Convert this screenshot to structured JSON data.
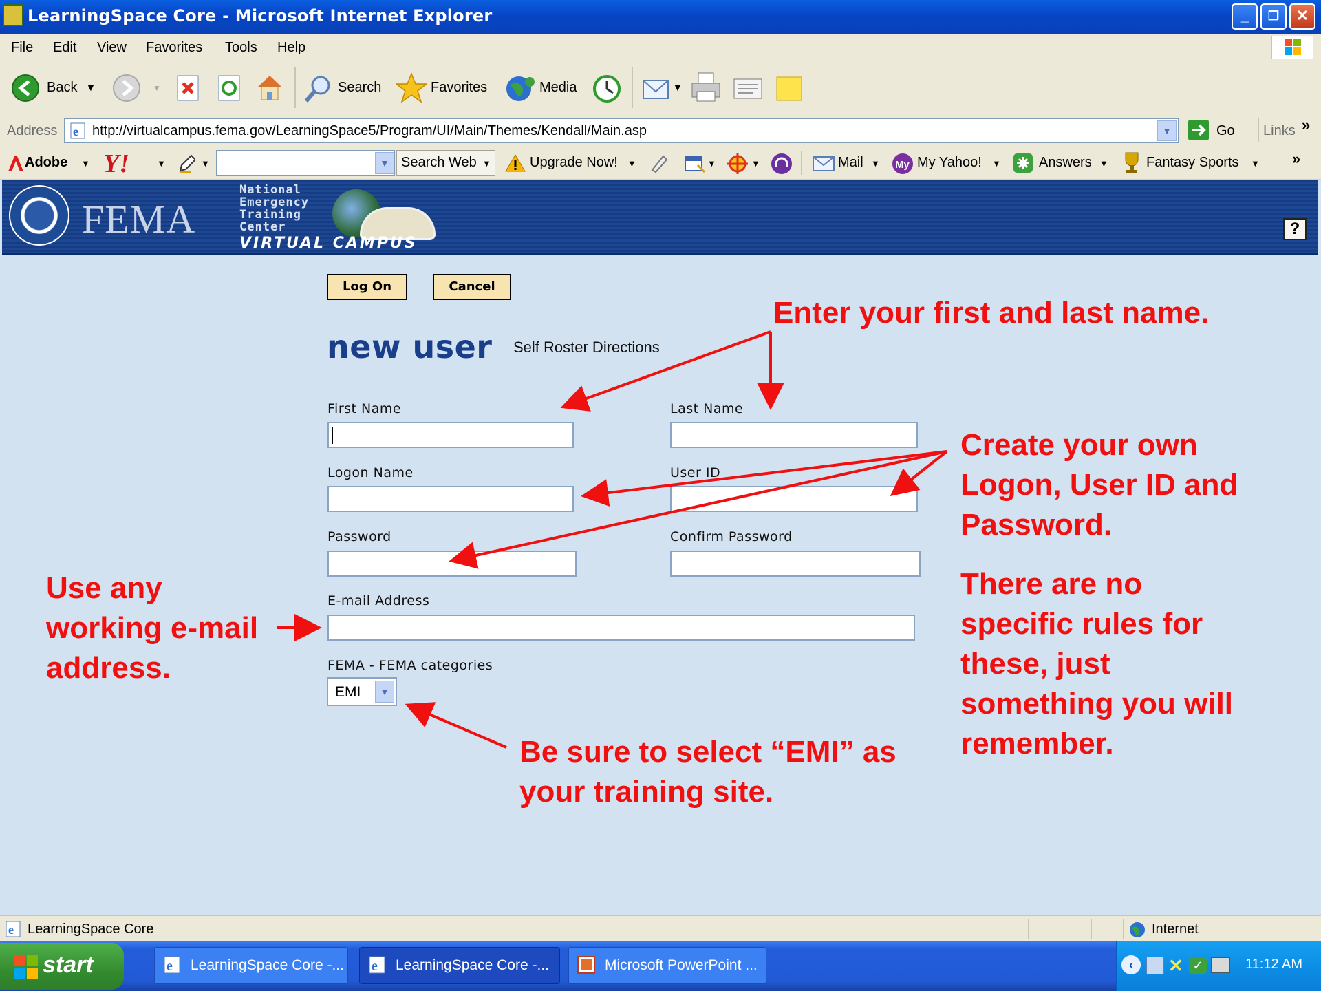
{
  "window": {
    "title": "LearningSpace Core - Microsoft Internet Explorer",
    "controls": [
      "_",
      "❐",
      "✕"
    ]
  },
  "menubar": {
    "items": [
      "File",
      "Edit",
      "View",
      "Favorites",
      "Tools",
      "Help"
    ]
  },
  "toolbar": {
    "back_label": "Back",
    "search_label": "Search",
    "favorites_label": "Favorites",
    "media_label": "Media"
  },
  "addressbar": {
    "label": "Address",
    "url": "http://virtualcampus.fema.gov/LearningSpace5/Program/UI/Main/Themes/Kendall/Main.asp",
    "go_label": "Go",
    "links_label": "Links",
    "overflow": "»"
  },
  "yahoobar": {
    "adobe_label": "Adobe",
    "yahoo_logo": "Y!",
    "search_web_label": "Search Web",
    "upgrade_label": "Upgrade Now!",
    "mail_label": "Mail",
    "my_yahoo_label": "My Yahoo!",
    "answers_label": "Answers",
    "fantasy_label": "Fantasy Sports",
    "overflow": "»"
  },
  "banner": {
    "agency": "FEMA",
    "ntc_lines": [
      "National",
      "Emergency",
      "Training",
      "Center"
    ],
    "campus": "VIRTUAL CAMPUS",
    "help": "?"
  },
  "form": {
    "logon_button": "Log On",
    "cancel_button": "Cancel",
    "heading": "new user",
    "directions_link": "Self Roster Directions",
    "first_name_label": "First Name",
    "last_name_label": "Last Name",
    "logon_name_label": "Logon Name",
    "user_id_label": "User ID",
    "password_label": "Password",
    "confirm_password_label": "Confirm Password",
    "email_label": "E-mail Address",
    "category_label": "FEMA - FEMA categories",
    "category_value": "EMI"
  },
  "annotations": {
    "name_note": "Enter your first and last name.",
    "credentials_note": [
      "Create your own",
      "Logon, User ID and",
      "Password."
    ],
    "rules_note": [
      "There are no",
      "specific rules for",
      "these, just",
      "something you will",
      "remember."
    ],
    "email_note": [
      "Use any",
      "working e-mail",
      "address."
    ],
    "site_note": [
      "Be sure to select “EMI” as",
      "your training site."
    ],
    "color": "#f01010"
  },
  "statusbar": {
    "text": "LearningSpace Core",
    "zone": "Internet"
  },
  "taskbar": {
    "start_label": "start",
    "tasks": [
      "LearningSpace Core -...",
      "LearningSpace Core -...",
      "Microsoft PowerPoint ..."
    ],
    "clock": "11:12 AM"
  },
  "colors": {
    "page_background": "#d3e2f1",
    "banner": "#173c84",
    "button_face": "#f7e4b1",
    "heading_blue": "#1a3f8a"
  }
}
